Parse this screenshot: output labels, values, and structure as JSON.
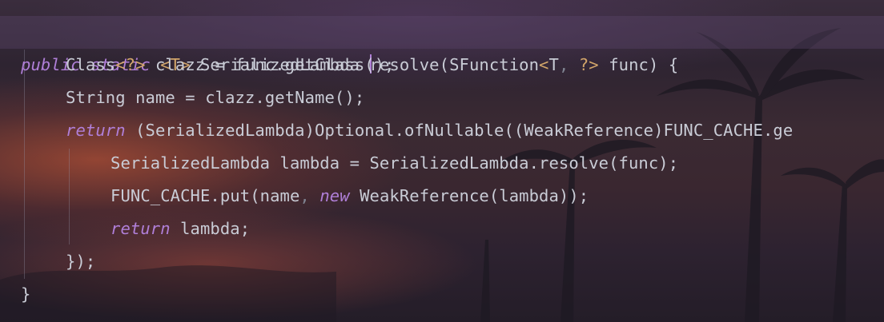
{
  "colors": {
    "keyword": "#b07fd8",
    "type_param": "#d2a56a",
    "default_text": "#c9ccd6",
    "comma": "#7f8391",
    "current_line": "#5c486c"
  },
  "code": {
    "l1": {
      "public": "public",
      "static": "static",
      "t_param": "<T>",
      "return_type": " SerializedLambda ",
      "method": "resolve",
      "open": "(SFunction",
      "lt": "<",
      "t": "T",
      "comma": ",",
      "wildcard": " ?",
      "gt": ">",
      "rest": " func) {"
    },
    "l2": {
      "class": "Class",
      "generic": "<?>",
      "rest": " clazz = func.getClass();"
    },
    "l3": "String name = clazz.getName();",
    "l4": {
      "return": "return",
      "rest": " (SerializedLambda)Optional.ofNullable((WeakReference)FUNC_CACHE.ge"
    },
    "l5": "SerializedLambda lambda = SerializedLambda.resolve(func);",
    "l6": {
      "start": "FUNC_CACHE.put(name",
      "comma": ",",
      "new": "new",
      "rest": " WeakReference(lambda));"
    },
    "l7": {
      "return": "return",
      "rest": " lambda;"
    },
    "l8": "});",
    "l9": "}"
  }
}
